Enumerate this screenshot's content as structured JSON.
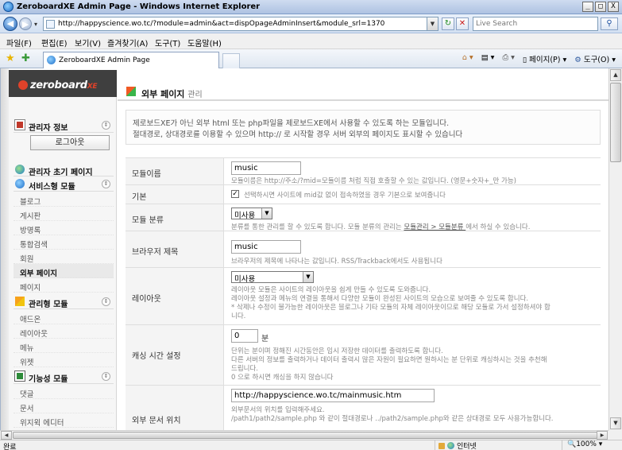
{
  "window": {
    "title": "ZeroboardXE Admin Page - Windows Internet Explorer",
    "min": "_",
    "max": "□",
    "close": "X"
  },
  "address": {
    "url": "http://happyscience.wo.tc/?module=admin&act=dispOpageAdminInsert&module_srl=1370",
    "search_placeholder": "Live Search"
  },
  "menu": [
    "파일(F)",
    "편집(E)",
    "보기(V)",
    "즐겨찾기(A)",
    "도구(T)",
    "도움말(H)"
  ],
  "tab": {
    "label": "ZeroboardXE Admin Page"
  },
  "commands": {
    "page": "페이지(P) ▾",
    "tools": "도구(O) ▾"
  },
  "logo": {
    "text": "zeroboard",
    "suffix": "XE"
  },
  "sidebar": {
    "admin_info": "관리자 정보",
    "logout": "로그아웃",
    "admin_home": "관리자 초기 페이지",
    "service_group": "서비스형 모듈",
    "service_items": [
      "블로그",
      "게시판",
      "방명록",
      "통합검색",
      "회원",
      "외부 페이지",
      "페이지"
    ],
    "admin_group": "관리형 모듈",
    "admin_items": [
      "애드온",
      "레이아웃",
      "메뉴",
      "위젯"
    ],
    "func_group": "기능성 모듈",
    "func_items": [
      "댓글",
      "문서",
      "위지윅 에디터"
    ]
  },
  "page": {
    "title": "외부 페이지",
    "subtitle": "관리",
    "desc_line1": "제로보드XE가 아닌 외부 html 또는 php파일을 제로보드XE에서 사용할 수 있도록 하는 모듈입니다.",
    "desc_line2": "절대경로, 상대경로를 이용할 수 있으며 http:// 로 시작할 경우 서버 외부의 페이지도 표시할 수 있습니다"
  },
  "form": {
    "module_name": {
      "label": "모듈이름",
      "value": "music",
      "hint": "모듈이름은 http://주소/?mid=모듈이름 처럼 직접 호출할 수 있는 값입니다. (영문+숫자+_만 가능)"
    },
    "default": {
      "label": "기본",
      "hint": "선택하시면 사이트에 mid값 없이 접속하였을 경우 기본으로 보여줍니다"
    },
    "category": {
      "label": "모듈 분류",
      "value": "미사용",
      "hint_pre": "분류를 통한 관리를 할 수 있도록 합니다. 모듈 분류의 관리는 ",
      "hint_link": "모듈관리 > 모듈분류 ",
      "hint_post": "에서 하실 수 있습니다."
    },
    "browser_title": {
      "label": "브라우저 제목",
      "value": "music",
      "hint": "브라우저의 제목에 나타나는 값입니다. RSS/Trackback에서도 사용됩니다"
    },
    "layout": {
      "label": "레이아웃",
      "value": "미사용",
      "hint1": "레이아웃 모듈은 사이트의 레이아웃을 쉽게 만들 수 있도록 도와줍니다.",
      "hint2": "레이아웃 설정과 메뉴의 연결을 통해서 다양한 모듈이 완성된 사이트의 모습으로 보여줄 수 있도록 합니다.",
      "hint3": "* 삭제나 수정이 불가능한 레이아웃은 블로그나 기타 모듈의 자체 레이아웃이므로 해당 모듈로 가서 설정하셔야 합",
      "hint4": "니다."
    },
    "cache": {
      "label": "캐싱 시간 설정",
      "value": "0",
      "unit": "분",
      "hint1": "단위는 분이며 정해진 시간동안은 임시 저장한 데이터를 출력하도록 합니다.",
      "hint2": "다른 서버의 정보를 출력하거나 데이터 출력시 많은 자원이 필요하면 원하시는 분 단위로 캐싱하시는 것을 추천해",
      "hint3": "드립니다.",
      "hint4": "0 으로 하시면 캐싱을 하지 않습니다"
    },
    "external_path": {
      "label": "외부 문서 위치",
      "value": "http://happyscience.wo.tc/mainmusic.htm",
      "hint1": "외부문서의 위치를 입력해주세요.",
      "hint2": "/path1/path2/sample.php 와 같이 절대경로나 ../path2/sample.php와 같은 상대경로 모두 사용가능합니다."
    }
  },
  "status": {
    "text": "완료",
    "zone": "인터넷",
    "zoom": "🔍100%  ▾"
  }
}
